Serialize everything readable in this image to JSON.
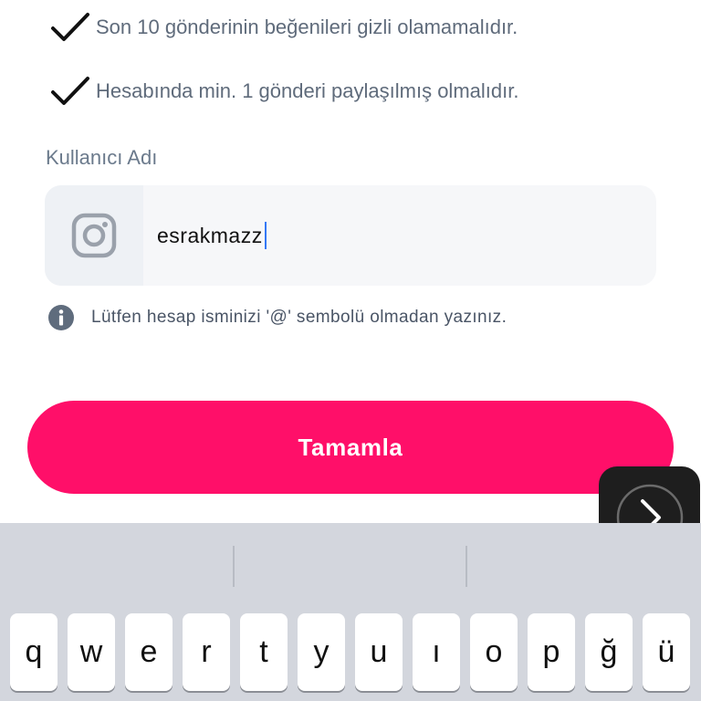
{
  "requirements": [
    {
      "text": "Son 10 gönderinin beğenileri gizli olamamalıdır.",
      "icon": "checkmark-icon"
    },
    {
      "text": "Hesabında min. 1 gönderi paylaşılmış olmalıdır.",
      "icon": "checkmark-icon"
    }
  ],
  "username_field": {
    "label": "Kullanıcı Adı",
    "value": "esrakmazz",
    "icon": "instagram-icon"
  },
  "hint": {
    "text": "Lütfen hesap isminizi '@' sembolü olmadan yazınız.",
    "icon": "info-icon"
  },
  "submit_button": {
    "label": "Tamamla",
    "color": "#ff0f69"
  },
  "next_button": {
    "icon": "chevron-right-icon"
  },
  "keyboard": {
    "top_row": [
      "q",
      "w",
      "e",
      "r",
      "t",
      "y",
      "u",
      "ı",
      "o",
      "p",
      "ğ",
      "ü"
    ]
  }
}
